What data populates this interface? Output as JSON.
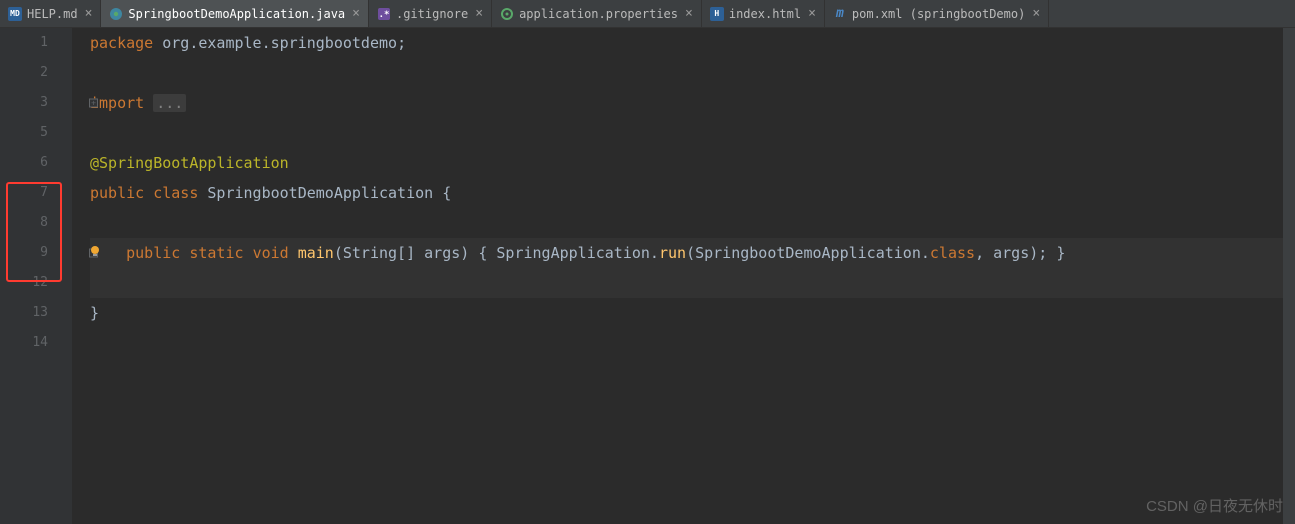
{
  "tabs": [
    {
      "label": "HELP.md",
      "icon": "md"
    },
    {
      "label": "SpringbootDemoApplication.java",
      "icon": "java",
      "active": true
    },
    {
      "label": ".gitignore",
      "icon": "git"
    },
    {
      "label": "application.properties",
      "icon": "prop"
    },
    {
      "label": "index.html",
      "icon": "html"
    },
    {
      "label": "pom.xml (springbootDemo)",
      "icon": "pom"
    }
  ],
  "lines": [
    "1",
    "2",
    "3",
    "5",
    "6",
    "7",
    "8",
    "9",
    "12",
    "13",
    "14"
  ],
  "code": {
    "l1_kw": "package",
    "l1_pkg": " org.example.springbootdemo",
    "l1_semi": ";",
    "l3_kw": "import",
    "l3_dots": "...",
    "l6_ann": "@SpringBootApplication",
    "l7_kw1": "public",
    "l7_kw2": "class",
    "l7_cls": "SpringbootDemoApplication",
    "l7_brace": "{",
    "l9_kw1": "public",
    "l9_kw2": "static",
    "l9_kw3": "void",
    "l9_fn": "main",
    "l9_args1": "(String[] ",
    "l9_args2": "args",
    "l9_args3": ")",
    "l9_brace1": " { ",
    "l9_call1": "SpringApplication.",
    "l9_call2": "run",
    "l9_call3": "(SpringbootDemoApplication.",
    "l9_call4": "class",
    "l9_call5": ", args); ",
    "l9_brace2": "}",
    "l13_brace": "}"
  },
  "watermark": "CSDN @日夜无休时"
}
